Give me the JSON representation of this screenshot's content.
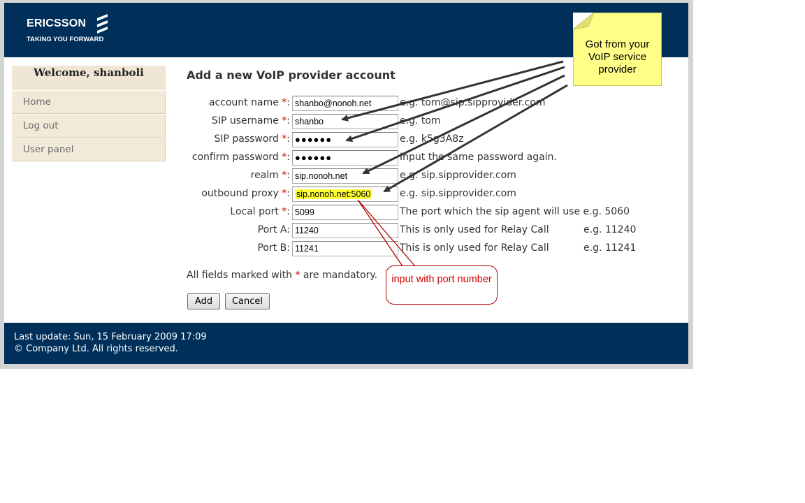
{
  "header": {
    "brand": "ERICSSON",
    "tagline": "TAKING YOU FORWARD",
    "logo_icon": "ericsson-logo-icon"
  },
  "sidebar": {
    "welcome": "Welcome, shanboli",
    "items": [
      {
        "label": "Home"
      },
      {
        "label": "Log out"
      },
      {
        "label": "User panel"
      }
    ]
  },
  "form": {
    "title": "Add a new VoIP provider account",
    "required_mark": "*",
    "fields": [
      {
        "label": "account name",
        "required": true,
        "value": "shanbo@nonoh.net",
        "hint": "e.g. tom@sip.sipprovider.com"
      },
      {
        "label": "SIP username",
        "required": true,
        "value": "shanbo",
        "hint": "e.g. tom"
      },
      {
        "label": "SIP password",
        "required": true,
        "value": "●●●●●●",
        "hint": "e.g. k5g3A8z"
      },
      {
        "label": "confirm password",
        "required": true,
        "value": "●●●●●●",
        "hint": "Input the same password again."
      },
      {
        "label": "realm",
        "required": true,
        "value": "sip.nonoh.net",
        "hint": "e.g. sip.sipprovider.com"
      },
      {
        "label": "outbound proxy",
        "required": true,
        "value": "sip.nonoh.net:5060",
        "hint": "e.g. sip.sipprovider.com"
      },
      {
        "label": "Local port",
        "required": true,
        "value": "5099",
        "hint": "The port which the sip agent will use e.g. 5060"
      },
      {
        "label": "Port A:",
        "required": false,
        "value": "11240",
        "hint": "This is only used for Relay Call",
        "hint2": "e.g. 11240"
      },
      {
        "label": "Port B:",
        "required": false,
        "value": "11241",
        "hint": "This is only used for Relay Call",
        "hint2": "e.g. 11241"
      }
    ],
    "mandatory_prefix": "All fields marked with",
    "mandatory_suffix": "are mandatory.",
    "add_button": "Add",
    "cancel_button": "Cancel"
  },
  "footer": {
    "last_update": "Last update: Sun, 15 February 2009 17:09",
    "copyright": "© Company Ltd. All rights reserved."
  },
  "annotations": {
    "sticky_note": "Got from your VoIP service provider",
    "callout": "input with port number"
  },
  "colors": {
    "header_bg": "#00305a",
    "required_star": "#cc0000",
    "sticky_note": "#ffff88",
    "callout_border": "#b00000",
    "highlight": "#ffff33"
  }
}
